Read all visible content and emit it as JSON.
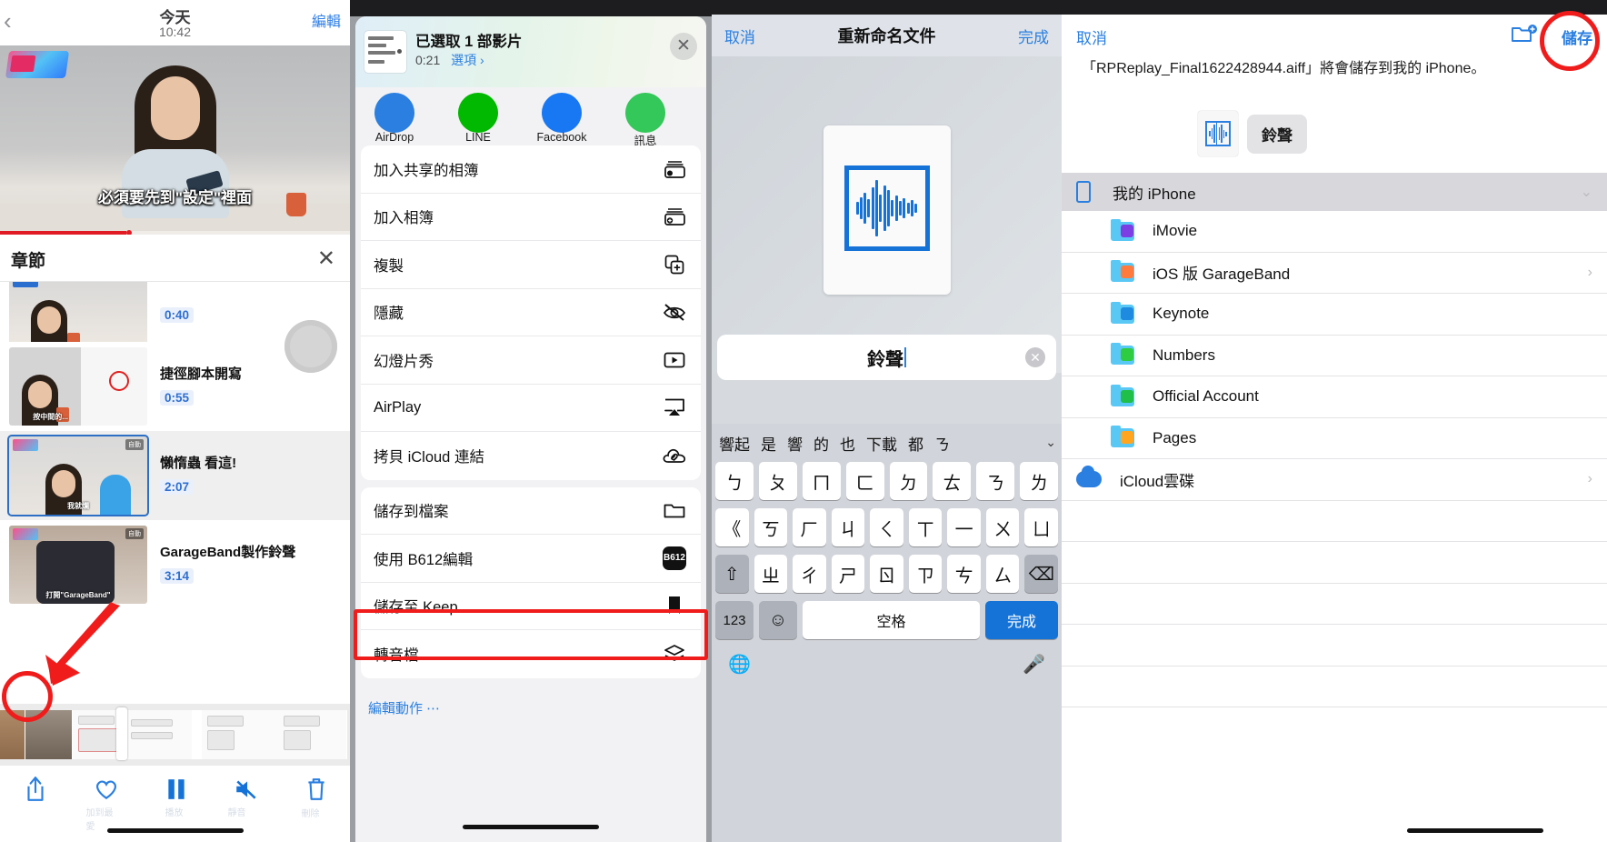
{
  "panel1": {
    "back_icon": "chevron-left-icon",
    "title": "今天",
    "time": "10:42",
    "edit": "編輯",
    "video_subtitle": "必須要先到\"設定\"裡面",
    "chapters_title": "章節",
    "close_icon": "close-icon",
    "chapters": [
      {
        "name": "",
        "time": "0:40"
      },
      {
        "name": "捷徑腳本開寫",
        "time": "0:55"
      },
      {
        "name": "懶惰蟲 看這!",
        "time": "2:07"
      },
      {
        "name": "GarageBand製作鈴聲",
        "time": "3:14"
      }
    ],
    "thumb_caption_1": "我就爛",
    "thumb_caption_2": "打開\"GarageBand\"",
    "toolbar": [
      {
        "icon": "share-icon",
        "label": ""
      },
      {
        "icon": "heart-icon",
        "label": "加到最愛"
      },
      {
        "icon": "pause-icon",
        "label": "播放"
      },
      {
        "icon": "mute-icon",
        "label": "靜音"
      },
      {
        "icon": "trash-icon",
        "label": "刪除"
      }
    ]
  },
  "panel2": {
    "header": {
      "title": "已選取 1 部影片",
      "duration": "0:21",
      "options": "選項 ›",
      "close_icon": "close-icon"
    },
    "apps": [
      {
        "label": "AirDrop",
        "color": "#2a7fe0"
      },
      {
        "label": "LINE",
        "color": "#00b900"
      },
      {
        "label": "Facebook",
        "color": "#1877f2"
      },
      {
        "label": "訊息",
        "color": "#34c759"
      }
    ],
    "groups": [
      {
        "items": [
          {
            "label": "加入共享的相簿",
            "icon": "shared-album-icon"
          },
          {
            "label": "加入相簿",
            "icon": "add-album-icon"
          },
          {
            "label": "複製",
            "icon": "duplicate-icon"
          },
          {
            "label": "隱藏",
            "icon": "hide-eye-icon"
          },
          {
            "label": "幻燈片秀",
            "icon": "slideshow-icon"
          },
          {
            "label": "AirPlay",
            "icon": "airplay-icon"
          },
          {
            "label": "拷貝 iCloud 連結",
            "icon": "icloud-link-icon"
          }
        ]
      },
      {
        "items": [
          {
            "label": "儲存到檔案",
            "icon": "folder-icon"
          },
          {
            "label": "使用 B612編輯",
            "icon": "b612-icon"
          },
          {
            "label": "儲存至 Keep",
            "icon": "bookmark-icon"
          },
          {
            "label": "轉音檔",
            "icon": "layers-icon",
            "highlighted": true
          }
        ]
      }
    ],
    "edit_actions": "編輯動作 ⋯"
  },
  "panel3": {
    "cancel": "取消",
    "title": "重新命名文件",
    "done": "完成",
    "file_icon": "audio-waveform-icon",
    "filename_value": "鈴聲",
    "clear_icon": "clear-field-icon",
    "keyboard": {
      "predictions": [
        "響起",
        "是",
        "響",
        "的",
        "也",
        "下載",
        "都",
        "ㄋ"
      ],
      "collapse_icon": "chevron-down-icon",
      "row1": [
        "ㄅ",
        "ㄆ",
        "ㄇ",
        "ㄈ",
        "ㄉ",
        "ㄊ",
        "ㄋ",
        "ㄌ"
      ],
      "row2": [
        "《",
        "ㄎ",
        "ㄏ",
        "ㄐ",
        "ㄑ",
        "ㄒ",
        "一",
        "ㄨ",
        "ㄩ"
      ],
      "row3": [
        "⇧",
        "ㄓ",
        "ㄔ",
        "ㄕ",
        "ㄖ",
        "ㄗ",
        "ㄘ",
        "ㄙ",
        "⌫"
      ],
      "num_key": "123",
      "emoji_key": "☺",
      "space_key": "空格",
      "enter_key": "完成",
      "globe_icon": "globe-icon",
      "mic_icon": "microphone-icon"
    }
  },
  "panel4": {
    "cancel": "取消",
    "new_folder_icon": "new-folder-icon",
    "save": "儲存",
    "message": "「RPReplay_Final1622428944.aiff」將會儲存到我的 iPhone。",
    "chip_label": "鈴聲",
    "chip_icon": "audio-waveform-icon",
    "root": {
      "label": "我的 iPhone",
      "icon": "iphone-icon",
      "chevron": "⌄"
    },
    "items": [
      {
        "label": "iMovie",
        "icon": "imovie-folder-icon",
        "color": "#5ac8f5",
        "badge": "#7b3fe4",
        "chevron": ""
      },
      {
        "label": "iOS 版 GarageBand",
        "icon": "garageband-folder-icon",
        "color": "#5ac8f5",
        "badge": "#ff7a3d",
        "chevron": "›"
      },
      {
        "label": "Keynote",
        "icon": "keynote-folder-icon",
        "color": "#5ac8f5",
        "badge": "#1e8ae0",
        "chevron": ""
      },
      {
        "label": "Numbers",
        "icon": "numbers-folder-icon",
        "color": "#5ac8f5",
        "badge": "#2ecc40",
        "chevron": ""
      },
      {
        "label": "Official Account",
        "icon": "official-account-folder-icon",
        "color": "#5ac8f5",
        "badge": "#1fbf4a",
        "chevron": ""
      },
      {
        "label": "Pages",
        "icon": "pages-folder-icon",
        "color": "#5ac8f5",
        "badge": "#ffa51f",
        "chevron": ""
      }
    ],
    "icloud": {
      "label": "iCloud雲碟",
      "icon": "icloud-icon",
      "chevron": "›"
    }
  },
  "colors": {
    "accent": "#2a7fe0",
    "highlight": "#f01c1c",
    "folder": "#5ac8f5"
  }
}
